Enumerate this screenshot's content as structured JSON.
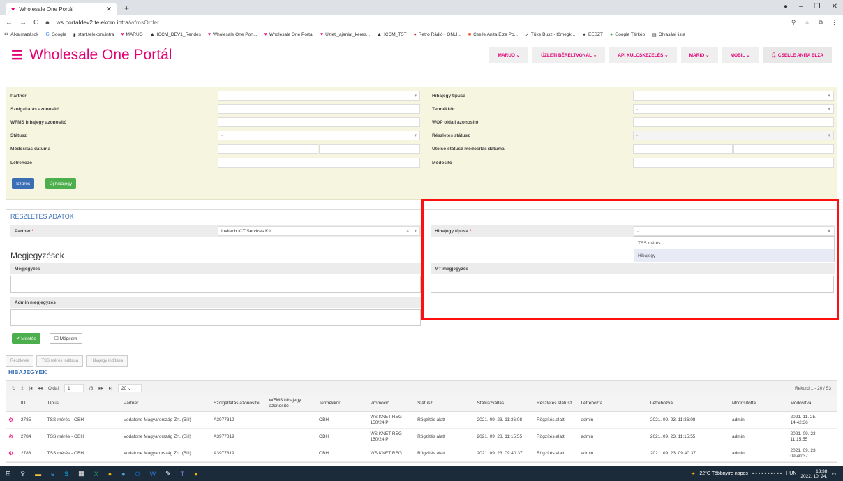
{
  "browser": {
    "tab_title": "Wholesale One Portál",
    "url_host": "ws.portaldev2.telekom.intra",
    "url_path": "/wfmsOrder",
    "bookmarks": [
      "Alkalmazások",
      "Google",
      "start.telekom.intra",
      "MARUO",
      "ICCM_DEV1_Rendes",
      "Wholesale One Port...",
      "Wholesale One Portal",
      "Uzleti_ajanlat_keres...",
      "ICCM_TST",
      "Retro Rádió - ONLI...",
      "Cselle Anita Elza Po...",
      "Tüke Busz - tömegk...",
      "EESZT",
      "Google Térkép",
      "Olvasási lista"
    ]
  },
  "header": {
    "title": "Wholesale One Portál",
    "nav": [
      "MARUO",
      "ÜZLETI BÉRELTVONAL",
      "API KULCSKEZELÉS",
      "MARIO",
      "MOBIL",
      "CSELLE ANITA ELZA"
    ]
  },
  "search": {
    "partner": "Partner",
    "szolg": "Szolgáltatás azonosító",
    "wfms": "WFMS hibajegy azonosító",
    "status": "Státusz",
    "mod_date": "Módosítás dátuma",
    "creator": "Létrehozó",
    "hiba_type": "Hibajegy típusa",
    "termekkor": "Termékkör",
    "wop": "WOP oldali azonosító",
    "det_status": "Részletes státusz",
    "last_status_date": "Utolsó státusz módosítás dátuma",
    "modifier": "Módosító",
    "dash": "-",
    "filter_btn": "Szűrés",
    "new_btn": "Új hibajegy"
  },
  "details": {
    "title": "RÉSZLETES ADATOK",
    "partner_label": "Partner",
    "partner_value": "Invitech ICT Services Kft.",
    "hiba_type_label": "Hibajegy típusa",
    "hiba_value": "-",
    "options": [
      "TSS mérés",
      "Hibajegy"
    ],
    "notes_title": "Megjegyzések",
    "note_label": "Megjegyzés",
    "mt_note_label": "MT megjegyzés",
    "admin_note_label": "Admin megjegyzés",
    "save": "Mentés",
    "cancel": "Mégsem",
    "req": "*"
  },
  "actions": [
    "Részletek",
    "TSS mérés indítása",
    "Hibajegy indítása"
  ],
  "table": {
    "title": "HIBAJEGYEK",
    "page_label": "Oldal",
    "page": "1",
    "pages": "/3",
    "per_page": "20",
    "record": "Rekord 1 - 20 / 53",
    "columns": [
      "ID",
      "Típus",
      "Partner",
      "Szolgáltatás azonosító",
      "WFMS hibajegy azonosító",
      "Termékkör",
      "Promóció",
      "Státusz",
      "Státuszváltás",
      "Részletes státusz",
      "Létrehozta",
      "Létrehozva",
      "Módosította",
      "Módosítva"
    ],
    "rows": [
      [
        "2785",
        "TSS mérés - OBH",
        "Vodafone Magyarország Zrt. (Bill)",
        "A3977819",
        "",
        "OBH",
        "WS KNET REG 150/24:P",
        "Rögzítés alatt",
        "2021. 09. 23. 11:36:08",
        "Rögzítés alatt",
        "admin",
        "2021. 09. 23. 11:36:08",
        "admin",
        "2021. 11. 25. 14:42:36"
      ],
      [
        "2784",
        "TSS mérés - OBH",
        "Vodafone Magyarország Zrt. (Bill)",
        "A3977819",
        "",
        "OBH",
        "WS KNET REG 150/24:P",
        "Rögzítés alatt",
        "2021. 09. 23. 11:15:55",
        "Rögzítés alatt",
        "admin",
        "2021. 09. 23. 11:15:55",
        "admin",
        "2021. 09. 23. 11:15:55"
      ],
      [
        "2783",
        "TSS mérés - OBH",
        "Vodafone Magyarország Zrt. (Bill)",
        "A3977819",
        "",
        "OBH",
        "WS KNET REG",
        "Rögzítés alatt",
        "2021. 09. 23. 09:40:37",
        "Rögzítés alatt",
        "admin",
        "2021. 09. 23. 09:40:37",
        "admin",
        "2021. 09. 23. 09:40:37"
      ]
    ]
  },
  "taskbar": {
    "weather": "22°C Többnyire napos",
    "lang": "HUN",
    "time": "13:38",
    "date": "2022. 10. 24."
  }
}
